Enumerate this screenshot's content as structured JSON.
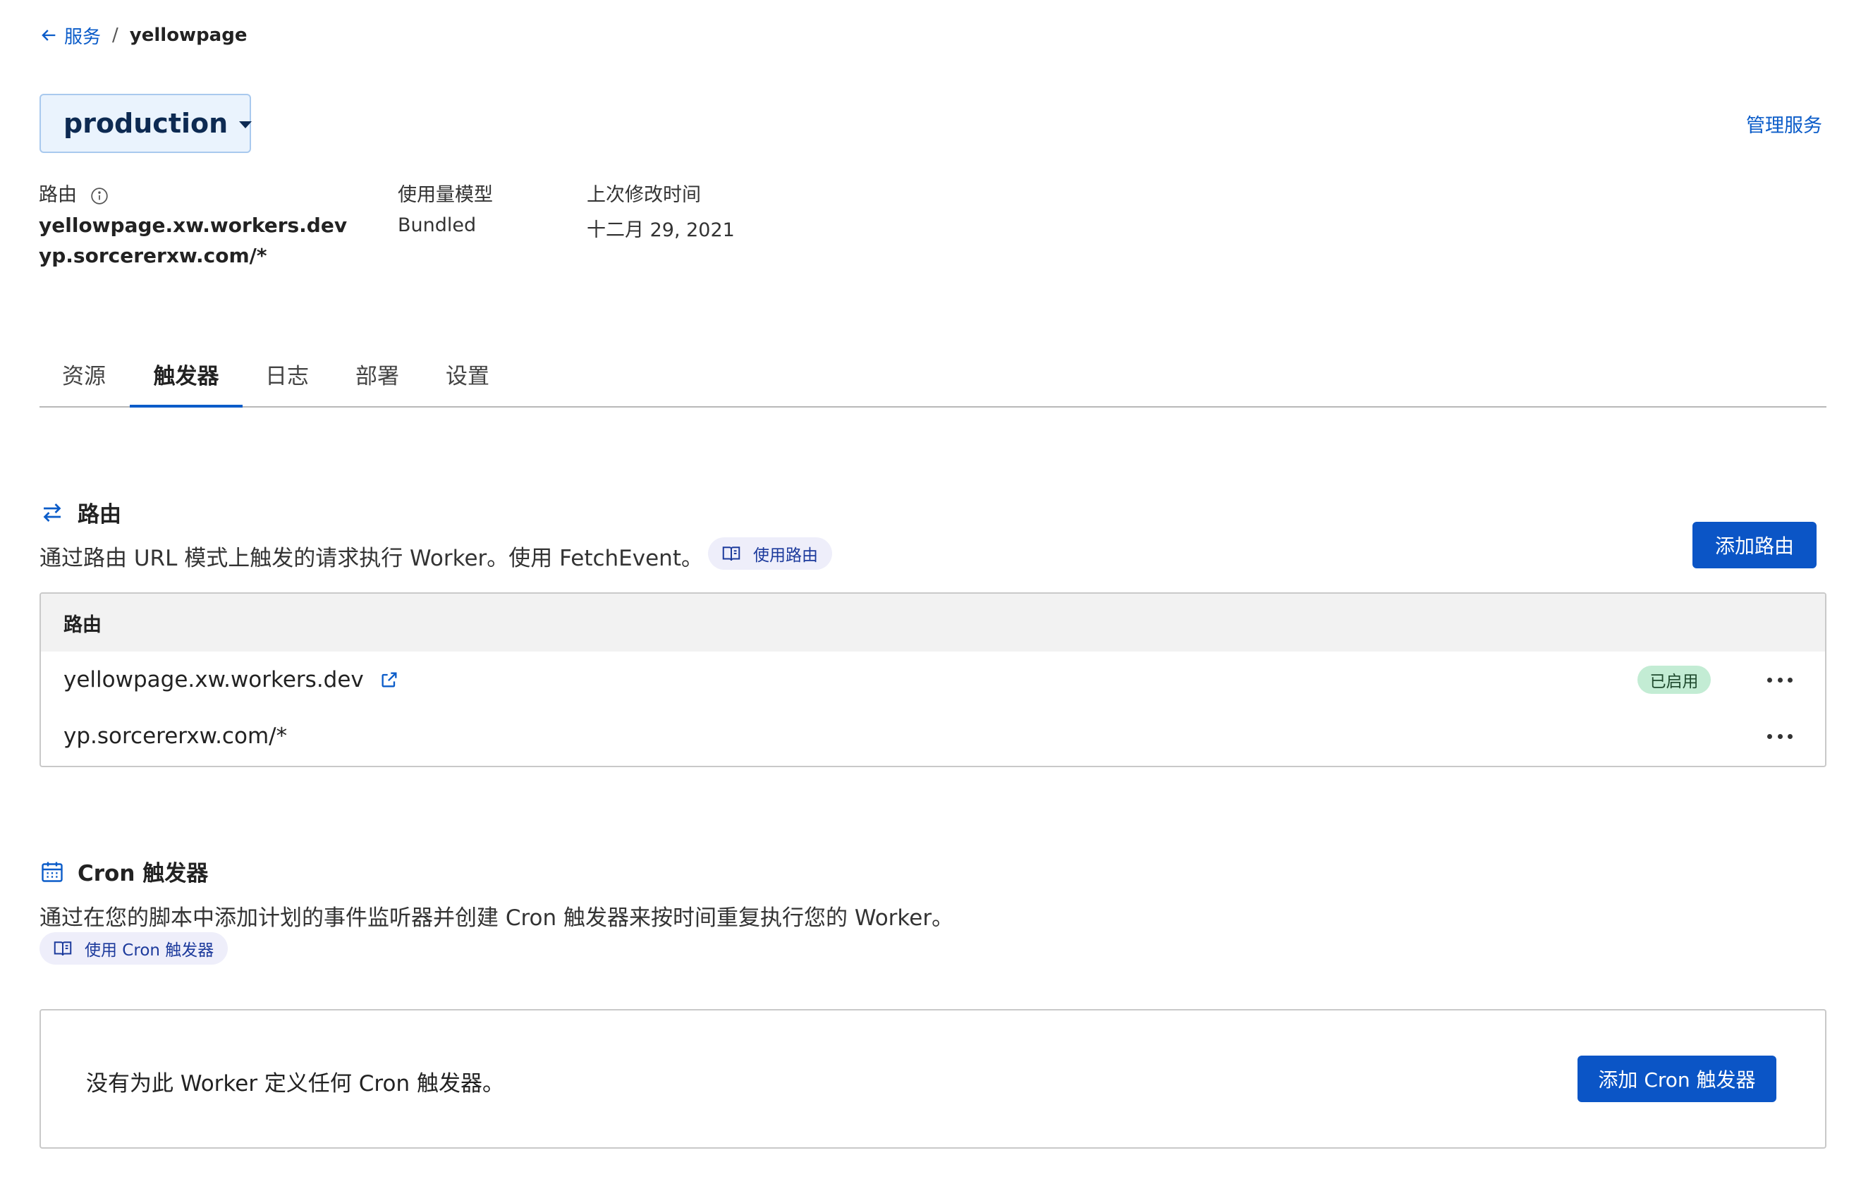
{
  "breadcrumb": {
    "back_label": "服务",
    "separator": "/",
    "current": "yellowpage"
  },
  "environment": {
    "selected": "production"
  },
  "header": {
    "manage_link": "管理服务"
  },
  "meta": {
    "routes_label": "路由",
    "routes": [
      "yellowpage.xw.workers.dev",
      "yp.sorcererxw.com/*"
    ],
    "usage_model_label": "使用量模型",
    "usage_model": "Bundled",
    "modified_label": "上次修改时间",
    "modified": "十二月 29, 2021"
  },
  "tabs": [
    {
      "label": "资源",
      "active": false
    },
    {
      "label": "触发器",
      "active": true
    },
    {
      "label": "日志",
      "active": false
    },
    {
      "label": "部署",
      "active": false
    },
    {
      "label": "设置",
      "active": false
    }
  ],
  "routes_section": {
    "title": "路由",
    "description": "通过路由 URL 模式上触发的请求执行 Worker。使用 FetchEvent。",
    "doc_link": "使用路由",
    "add_button": "添加路由",
    "table_header": "路由",
    "rows": [
      {
        "route": "yellowpage.xw.workers.dev",
        "status": "已启用"
      },
      {
        "route": "yp.sorcererxw.com/*",
        "status": ""
      }
    ]
  },
  "cron_section": {
    "title": "Cron 触发器",
    "description": "通过在您的脚本中添加计划的事件监听器并创建 Cron 触发器来按时间重复执行您的 Worker。",
    "doc_link": "使用 Cron 触发器",
    "empty_message": "没有为此 Worker 定义任何 Cron 触发器。",
    "add_button": "添加 Cron 触发器"
  },
  "colors": {
    "accent": "#0b55c6",
    "link": "#0b5cc9",
    "enabled_badge": "#c3ecd4"
  },
  "icons": [
    "arrow-left-icon",
    "chevron-down-icon",
    "info-icon",
    "swap-arrows-icon",
    "book-icon",
    "external-link-icon",
    "more-dots-icon",
    "calendar-icon"
  ]
}
